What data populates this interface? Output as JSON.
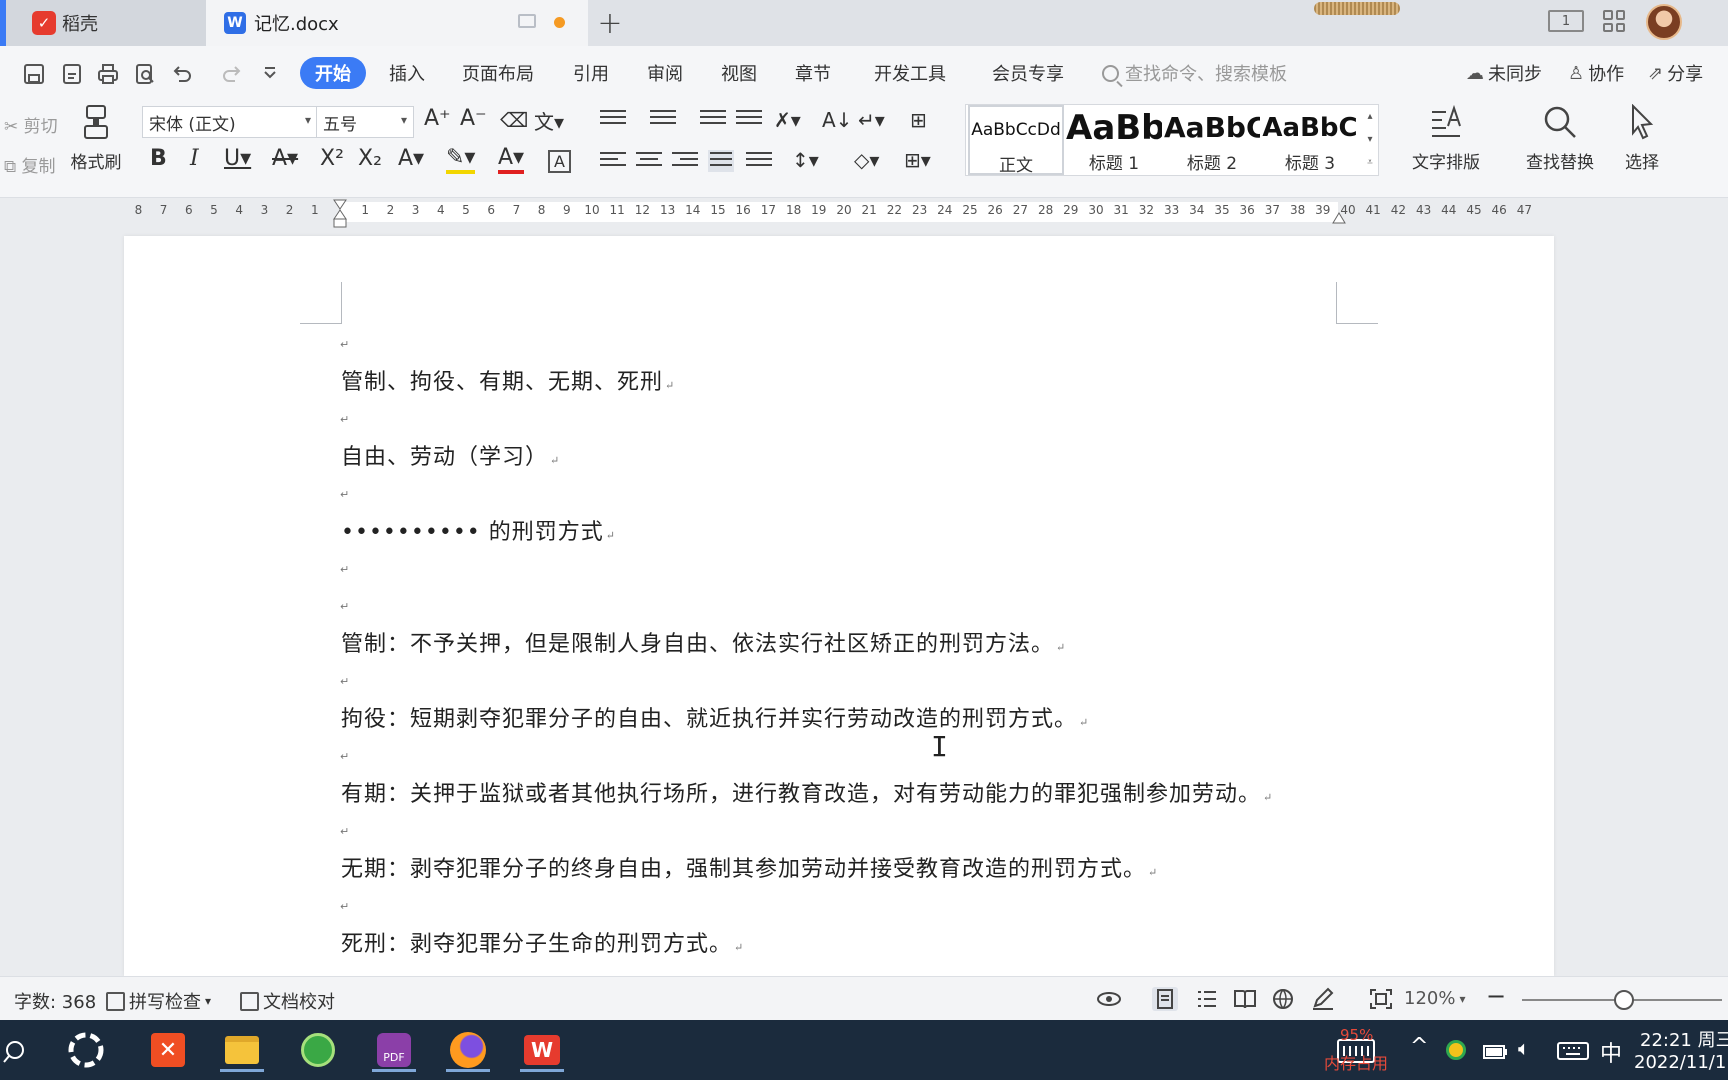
{
  "tabs": {
    "home_label": "稻壳",
    "doc_label": "记忆.docx",
    "new_tab": "+"
  },
  "window": {
    "layout_badge": "1"
  },
  "menu": {
    "items": [
      "开始",
      "插入",
      "页面布局",
      "引用",
      "审阅",
      "视图",
      "章节",
      "开发工具",
      "会员专享"
    ],
    "active": "开始",
    "search_placeholder": "查找命令、搜索模板",
    "sync": "未同步",
    "collab": "协作",
    "share": "分享"
  },
  "ribbon": {
    "cut": "剪切",
    "copy": "复制",
    "format_painter": "格式刷",
    "font_name": "宋体 (正文)",
    "font_size": "五号",
    "styles": [
      {
        "sample": "AaBbCcDd",
        "name": "正文"
      },
      {
        "sample": "AaBb",
        "name": "标题 1"
      },
      {
        "sample": "AaBbC",
        "name": "标题 2"
      },
      {
        "sample": "AaBbC",
        "name": "标题 3"
      }
    ],
    "text_layout": "文字排版",
    "find_replace": "查找替换",
    "select": "选择"
  },
  "ruler": {
    "left_numbers": [
      "8",
      "7",
      "6",
      "5",
      "4",
      "3",
      "2",
      "1"
    ],
    "right_numbers": [
      "1",
      "2",
      "3",
      "4",
      "5",
      "6",
      "7",
      "8",
      "9",
      "10",
      "11",
      "12",
      "13",
      "14",
      "15",
      "16",
      "17",
      "18",
      "19",
      "20",
      "21",
      "22",
      "23",
      "24",
      "25",
      "26",
      "27",
      "28",
      "29",
      "30",
      "31",
      "32",
      "33",
      "34",
      "35",
      "36",
      "37",
      "38",
      "39",
      "40",
      "41",
      "42",
      "43",
      "44",
      "45",
      "46",
      "47"
    ]
  },
  "document": {
    "lines": [
      "管制、拘役、有期、无期、死刑",
      "自由、劳动（学习）",
      "••••••••••  的刑罚方式",
      "管制：不予关押，但是限制人身自由、依法实行社区矫正的刑罚方法。",
      "拘役：短期剥夺犯罪分子的自由、就近执行并实行劳动改造的刑罚方式。",
      "有期：关押于监狱或者其他执行场所，进行教育改造，对有劳动能力的罪犯强制参加劳动。",
      "无期：剥夺犯罪分子的终身自由，强制其参加劳动并接受教育改造的刑罚方式。",
      "死刑：剥夺犯罪分子生命的刑罚方式。"
    ],
    "paragraph_mark": "↵"
  },
  "status": {
    "word_count": "字数: 368",
    "spell_check": "拼写检查",
    "doc_proof": "文档校对",
    "zoom": "120%"
  },
  "taskbar": {
    "memory_pct": "95%",
    "memory_label": "内存占用",
    "ime": "中",
    "time": "22:21 周三",
    "date": "2022/11/1"
  },
  "colors": {
    "accent": "#3b7bf5",
    "taskbar": "#1b2b3d",
    "wps_red": "#e63b2e"
  }
}
